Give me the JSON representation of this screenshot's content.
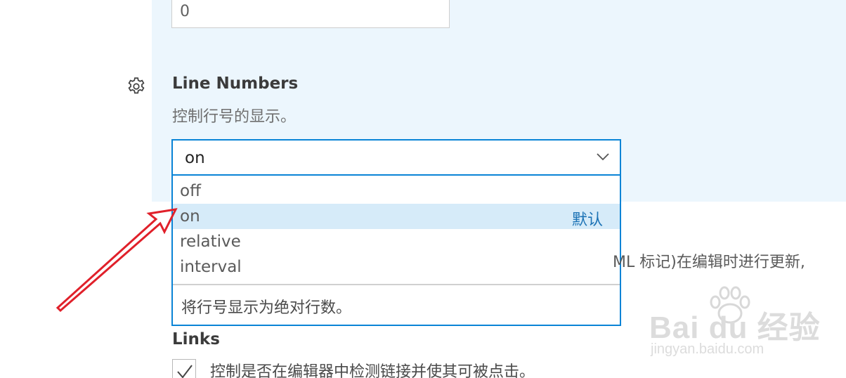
{
  "top_input": {
    "value": "0"
  },
  "line_numbers": {
    "title": "Line Numbers",
    "description": "控制行号的显示。",
    "selected_value": "on",
    "options": [
      {
        "label": "off"
      },
      {
        "label": "on",
        "badge": "默认",
        "selected": true
      },
      {
        "label": "relative"
      },
      {
        "label": "interval"
      }
    ],
    "option_description": "将行号显示为绝对行数。"
  },
  "obscured_setting_text": "ML 标记)在编辑时进行更新,",
  "links": {
    "title": "Links",
    "checked": true,
    "description": "控制是否在编辑器中检测链接并使其可被点击。"
  },
  "watermark": {
    "main": "Bai du 经验",
    "sub": "jingyan.baidu.com"
  },
  "colors": {
    "accent": "#0a84d6",
    "highlight_bg": "#ecf6fd",
    "selected_option_bg": "#d6ebf9",
    "annotation_arrow": "#e0202a"
  },
  "icons": [
    "gear-icon",
    "chevron-down-icon",
    "check-icon",
    "annotation-arrow"
  ]
}
